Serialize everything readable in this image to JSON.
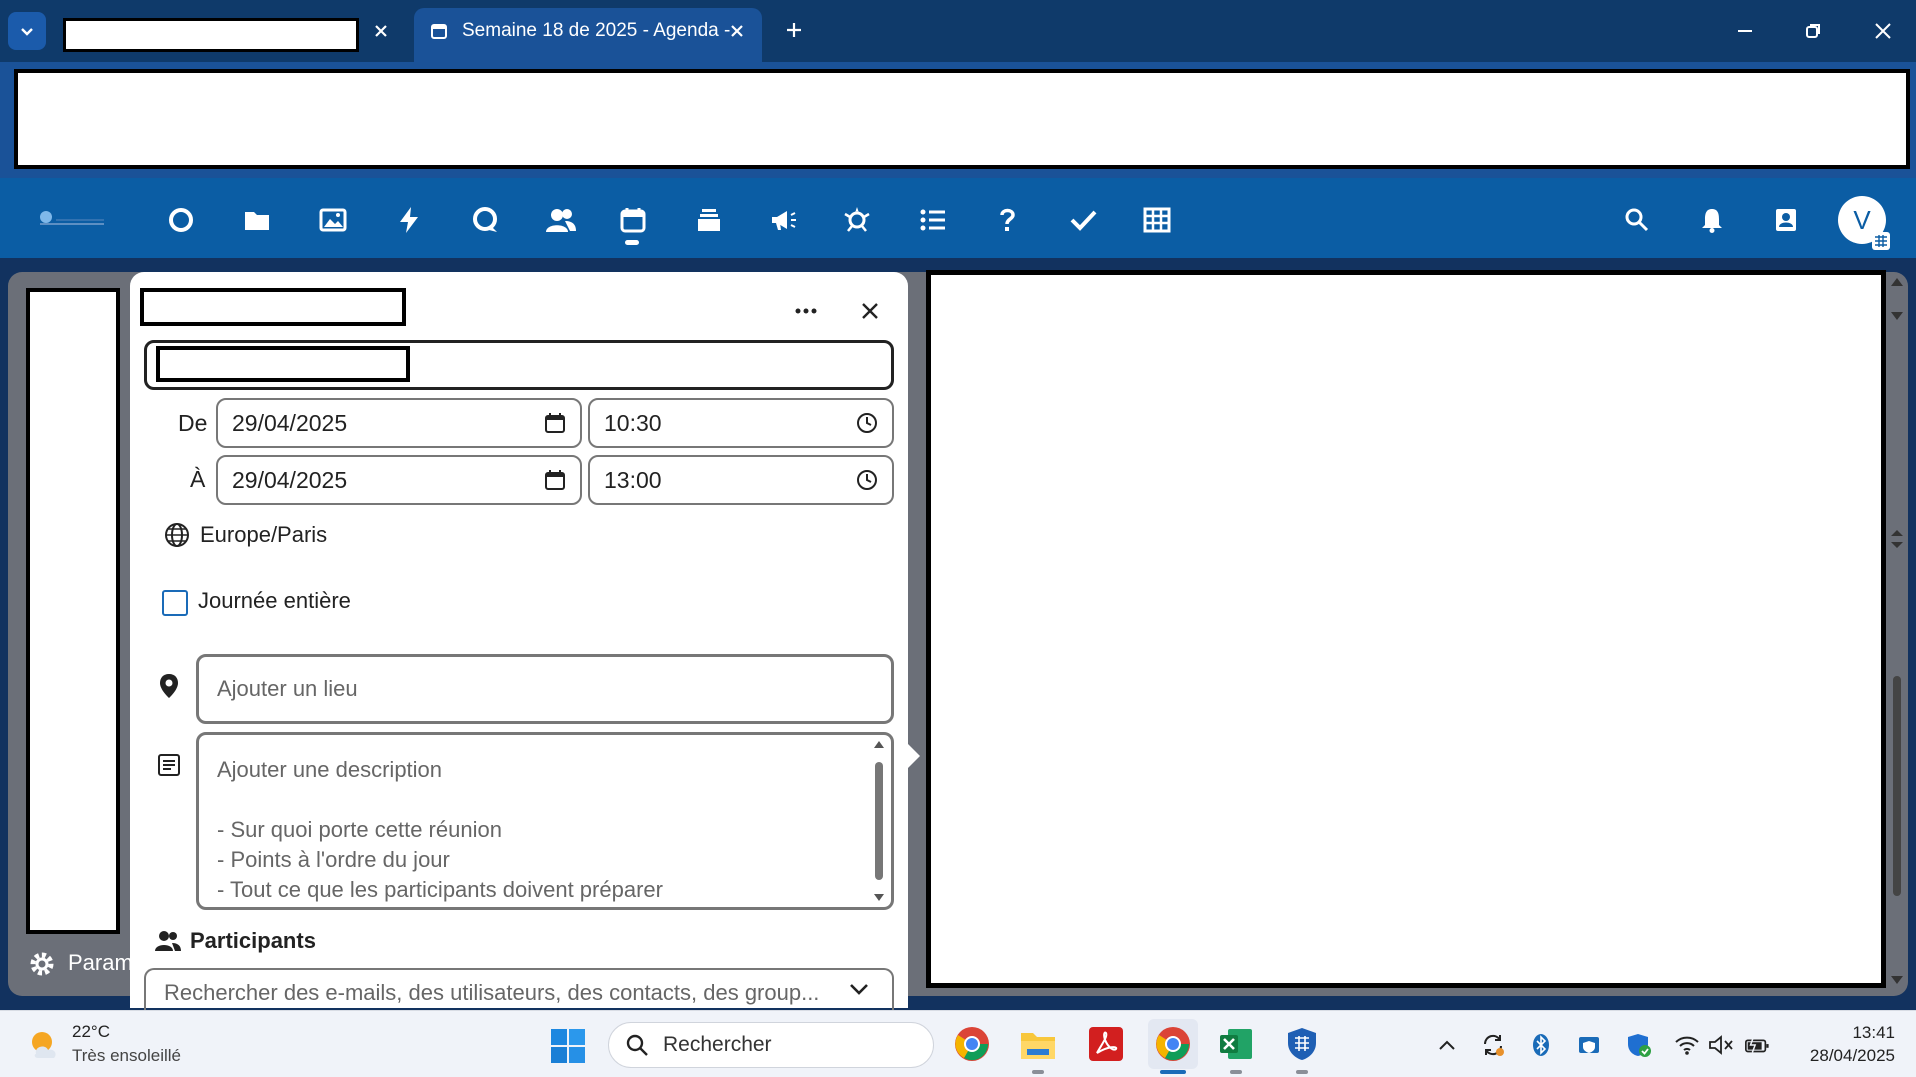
{
  "browser": {
    "active_tab_title": "Semaine 18 de 2025 - Agenda -"
  },
  "settings": {
    "label": "Param"
  },
  "event_modal": {
    "from_label": "De",
    "to_label": "À",
    "from_date": "29/04/2025",
    "from_time": "10:30",
    "to_date": "29/04/2025",
    "to_time": "13:00",
    "timezone": "Europe/Paris",
    "all_day_label": "Journée entière",
    "all_day_checked": false,
    "location_placeholder": "Ajouter un lieu",
    "description_placeholder_lines": [
      "Ajouter une description",
      "",
      "- Sur quoi porte cette réunion",
      "- Points à l'ordre du jour",
      "- Tout ce que les participants doivent préparer"
    ],
    "participants_label": "Participants",
    "participants_search_placeholder": "Rechercher des e-mails, des utilisateurs, des contacts, des group..."
  },
  "header": {
    "avatar_initial": "V",
    "apps": [
      "dashboard-icon",
      "files-icon",
      "photos-icon",
      "activity-icon",
      "talk-icon",
      "contacts-icon",
      "calendar-icon",
      "deck-icon",
      "announcements-icon",
      "spreed-icon",
      "tasks-list-icon",
      "help-icon",
      "checkmark-icon",
      "spreadsheet-icon"
    ]
  },
  "taskbar": {
    "weather_temp": "22°C",
    "weather_desc": "Très ensoleillé",
    "search_placeholder": "Rechercher",
    "time": "13:41",
    "date": "28/04/2025"
  },
  "colors": {
    "titlebar": "#0f3a6a",
    "address_area": "#1a5298",
    "appbar": "#0b5da4",
    "checkbox_border": "#1a6bb8"
  }
}
